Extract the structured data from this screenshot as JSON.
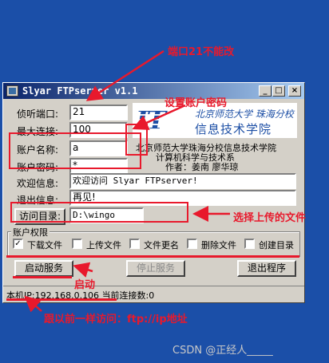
{
  "window": {
    "title": "Slyar FTPserver v1.1",
    "minimize_glyph": "_",
    "maximize_glyph": "□",
    "close_glyph": "×"
  },
  "form": {
    "port_label": "侦听端口:",
    "port_value": "21",
    "max_conn_label": "最大连接:",
    "max_conn_value": "100",
    "account_label": "账户名称:",
    "account_value": "a",
    "password_label": "账户密码:",
    "password_value": "*",
    "welcome_label": "欢迎信息:",
    "welcome_value": "欢迎访问 Slyar FTPserver!",
    "exit_label": "退出信息:",
    "exit_value": "再见!",
    "dir_button": "访问目录:",
    "dir_value": "D:\\wingo"
  },
  "logo": {
    "it": "IT",
    "line1": "北京师范大学 珠海分校",
    "line2": "信息技术学院"
  },
  "credits": {
    "line1": "北京师范大学珠海分校信息技术学院",
    "line2": "计算机科学与技术系",
    "line3": "作者：姜南  廖华琼"
  },
  "permissions": {
    "title": "账户权限",
    "items": [
      {
        "label": "下载文件",
        "checked": true
      },
      {
        "label": "上传文件",
        "checked": false
      },
      {
        "label": "文件更名",
        "checked": false
      },
      {
        "label": "删除文件",
        "checked": false
      },
      {
        "label": "创建目录",
        "checked": false
      }
    ]
  },
  "buttons": {
    "start": "启动服务",
    "stop": "停止服务",
    "exit": "退出程序"
  },
  "status": "本机IP:192.168.0.106 当前连接数:0",
  "annotations": {
    "port_note": "端口21不能改",
    "account_note": "设置账户密码",
    "dir_note": "选择上传的文件",
    "start_note": "启动",
    "ip_note": "跟以前一样访问：ftp://ip地址",
    "color": "#e8192c"
  },
  "watermark": "CSDN @正经人_____"
}
